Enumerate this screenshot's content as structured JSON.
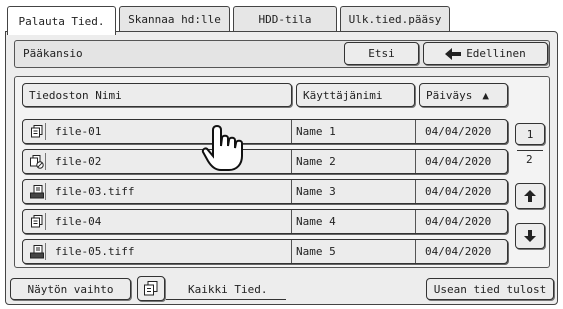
{
  "tabs": [
    {
      "label": "Palauta Tied."
    },
    {
      "label": "Skannaa hd:lle"
    },
    {
      "label": "HDD-tila"
    },
    {
      "label": "Ulk.tied.pääsy"
    }
  ],
  "folder": {
    "path": "Pääkansio",
    "search_label": "Etsi",
    "back_label": "Edellinen"
  },
  "columns": {
    "name": "Tiedoston Nimi",
    "user": "Käyttäjänimi",
    "date": "Päiväys",
    "sort_indicator": "▲"
  },
  "files": [
    {
      "name": "file-01",
      "user": "Name 1",
      "date": "04/04/2020",
      "icon": "document-copy-icon"
    },
    {
      "name": "file-02",
      "user": "Name 2",
      "date": "04/04/2020",
      "icon": "document-copy-locked-icon"
    },
    {
      "name": "file-03.tiff",
      "user": "Name 3",
      "date": "04/04/2020",
      "icon": "scanner-document-icon"
    },
    {
      "name": "file-04",
      "user": "Name 4",
      "date": "04/04/2020",
      "icon": "document-copy-icon"
    },
    {
      "name": "file-05.tiff",
      "user": "Name 5",
      "date": "04/04/2020",
      "icon": "scanner-document-icon"
    }
  ],
  "pagination": {
    "current": "1",
    "total": "2"
  },
  "bottom": {
    "view_switch_label": "Näytön vaihto",
    "filter_label": "Kaikki Tied.",
    "multi_print_label": "Usean tied tulost"
  }
}
